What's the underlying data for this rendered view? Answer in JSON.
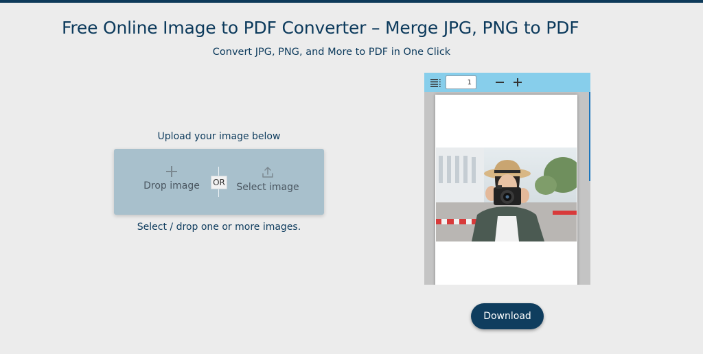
{
  "header": {
    "title": "Free Online Image to PDF Converter – Merge JPG, PNG to PDF",
    "subtitle": "Convert JPG, PNG, and More to PDF in One Click"
  },
  "upload": {
    "caption": "Upload your image below",
    "drop_label": "Drop image",
    "or_label": "OR",
    "select_label": "Select image",
    "hint": "Select / drop one or more images.",
    "drop_icon": "plus-icon",
    "select_icon": "upload-icon"
  },
  "viewer": {
    "page_number": "1",
    "menu_icon": "menu-icon",
    "zoom_out_icon": "minus-icon",
    "zoom_in_icon": "plus-icon",
    "toolbar_color": "#87ceeb"
  },
  "actions": {
    "download_label": "Download",
    "download_color": "#0f3d5e"
  }
}
